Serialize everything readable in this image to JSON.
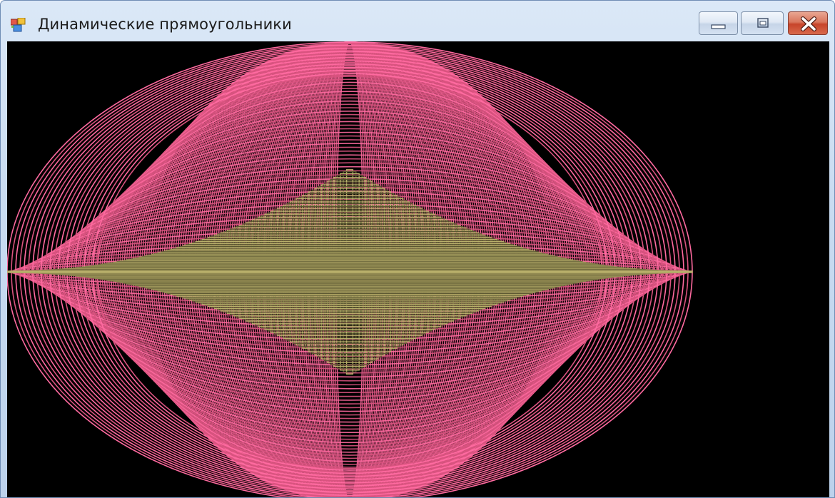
{
  "window": {
    "title": "Динамические прямоугольники",
    "icon": "windows-form-app-icon",
    "controls": {
      "minimize_icon": "minimize-icon",
      "maximize_icon": "maximize-icon",
      "close_icon": "close-icon"
    }
  },
  "canvas": {
    "background_color": "#000000",
    "ellipse_color": "#d9537f",
    "ellipse_highlight_color": "#ff6aa0",
    "rectangle_color": "#b9b06b",
    "rectangle_dark_color": "#5a5630"
  }
}
